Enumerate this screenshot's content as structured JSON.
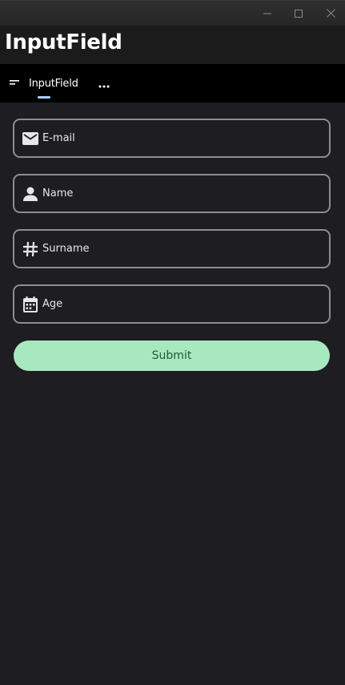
{
  "window": {
    "controls": {
      "minimize_icon": "minimize-icon",
      "maximize_icon": "maximize-icon",
      "close_icon": "close-icon"
    }
  },
  "header": {
    "title": "InputField"
  },
  "nav": {
    "tabs": [
      {
        "label": "InputField",
        "icon": "menu-lines-icon",
        "selected": true
      }
    ],
    "more_icon": "more-horizontal-icon"
  },
  "form": {
    "fields": [
      {
        "placeholder": "E-mail",
        "value": "",
        "icon": "envelope-icon"
      },
      {
        "placeholder": "Name",
        "value": "",
        "icon": "person-icon"
      },
      {
        "placeholder": "Surname",
        "value": "",
        "icon": "hash-icon"
      },
      {
        "placeholder": "Age",
        "value": "",
        "icon": "calendar-icon"
      }
    ],
    "submit_label": "Submit"
  },
  "colors": {
    "background": "#1e1d22",
    "header_background": "#1b1b1b",
    "navbar_background": "#000000",
    "field_border": "#8e8c93",
    "tab_indicator": "#a8d2ff",
    "submit_background": "#a7e8c1",
    "submit_text": "#1d5d32"
  }
}
